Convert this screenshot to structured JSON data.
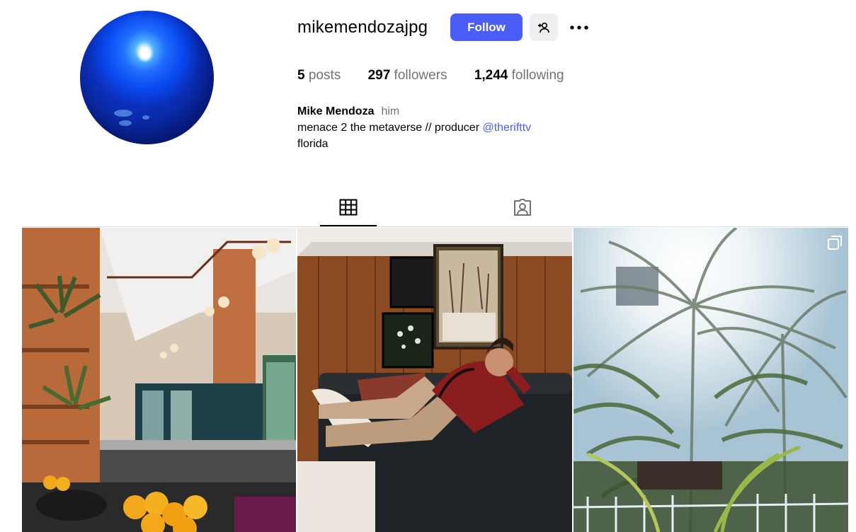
{
  "profile": {
    "username": "mikemendozajpg",
    "follow_label": "Follow",
    "suggest_icon": "person-add-icon",
    "more_icon": "more-horizontal-icon",
    "stats": {
      "posts_count": "5",
      "posts_label": "posts",
      "followers_count": "297",
      "followers_label": "followers",
      "following_count": "1,244",
      "following_label": "following"
    },
    "bio": {
      "full_name": "Mike Mendoza",
      "pronouns": "him",
      "text": "menace 2 the metaverse // producer ",
      "mention": "@therifttv",
      "location": "florida"
    }
  },
  "tabs": [
    {
      "icon": "grid-icon",
      "active": true
    },
    {
      "icon": "tagged-icon",
      "active": false
    }
  ],
  "posts": [
    {
      "subject": "restaurant-interior-photo"
    },
    {
      "subject": "man-on-couch-photo"
    },
    {
      "subject": "palm-trees-photo",
      "badge": "multi-photo-icon"
    }
  ],
  "colors": {
    "accent": "#4a5df9",
    "muted": "#737373",
    "divider": "#dbdbdb"
  }
}
